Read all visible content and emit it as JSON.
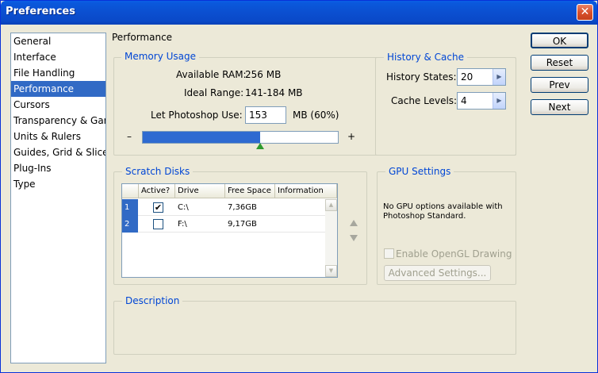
{
  "window": {
    "title": "Preferences",
    "close_glyph": "✕"
  },
  "sidebar": {
    "items": [
      {
        "label": "General"
      },
      {
        "label": "Interface"
      },
      {
        "label": "File Handling"
      },
      {
        "label": "Performance"
      },
      {
        "label": "Cursors"
      },
      {
        "label": "Transparency & Gamut"
      },
      {
        "label": "Units & Rulers"
      },
      {
        "label": "Guides, Grid & Slices"
      },
      {
        "label": "Plug-Ins"
      },
      {
        "label": "Type"
      }
    ],
    "selected_index": 3
  },
  "page": {
    "title": "Performance"
  },
  "memory": {
    "legend": "Memory Usage",
    "available_label": "Available RAM:",
    "available_value": "256 MB",
    "ideal_label": "Ideal Range:",
    "ideal_value": "141-184 MB",
    "use_label": "Let Photoshop Use:",
    "use_value": "153",
    "use_suffix": "MB (60%)",
    "slider_minus": "–",
    "slider_plus": "+",
    "slider_fraction": 0.6
  },
  "history": {
    "legend": "History & Cache",
    "states_label": "History States:",
    "states_value": "20",
    "levels_label": "Cache Levels:",
    "levels_value": "4"
  },
  "scratch": {
    "legend": "Scratch Disks",
    "columns": [
      "Active?",
      "Drive",
      "Free Space",
      "Information"
    ],
    "rows": [
      {
        "num": "1",
        "active": true,
        "drive": "C:\\",
        "free": "7,36GB",
        "info": ""
      },
      {
        "num": "2",
        "active": false,
        "drive": "F:\\",
        "free": "9,17GB",
        "info": ""
      }
    ]
  },
  "gpu": {
    "legend": "GPU Settings",
    "message": "No GPU options available with Photoshop Standard.",
    "opengl_label": "Enable OpenGL Drawing",
    "advanced_label": "Advanced Settings..."
  },
  "description": {
    "legend": "Description"
  },
  "buttons": {
    "ok": "OK",
    "reset": "Reset",
    "prev": "Prev",
    "next": "Next"
  },
  "icons": {
    "spin_right": "▶",
    "check": "✔",
    "scroll_up": "▲",
    "scroll_down": "▼"
  }
}
